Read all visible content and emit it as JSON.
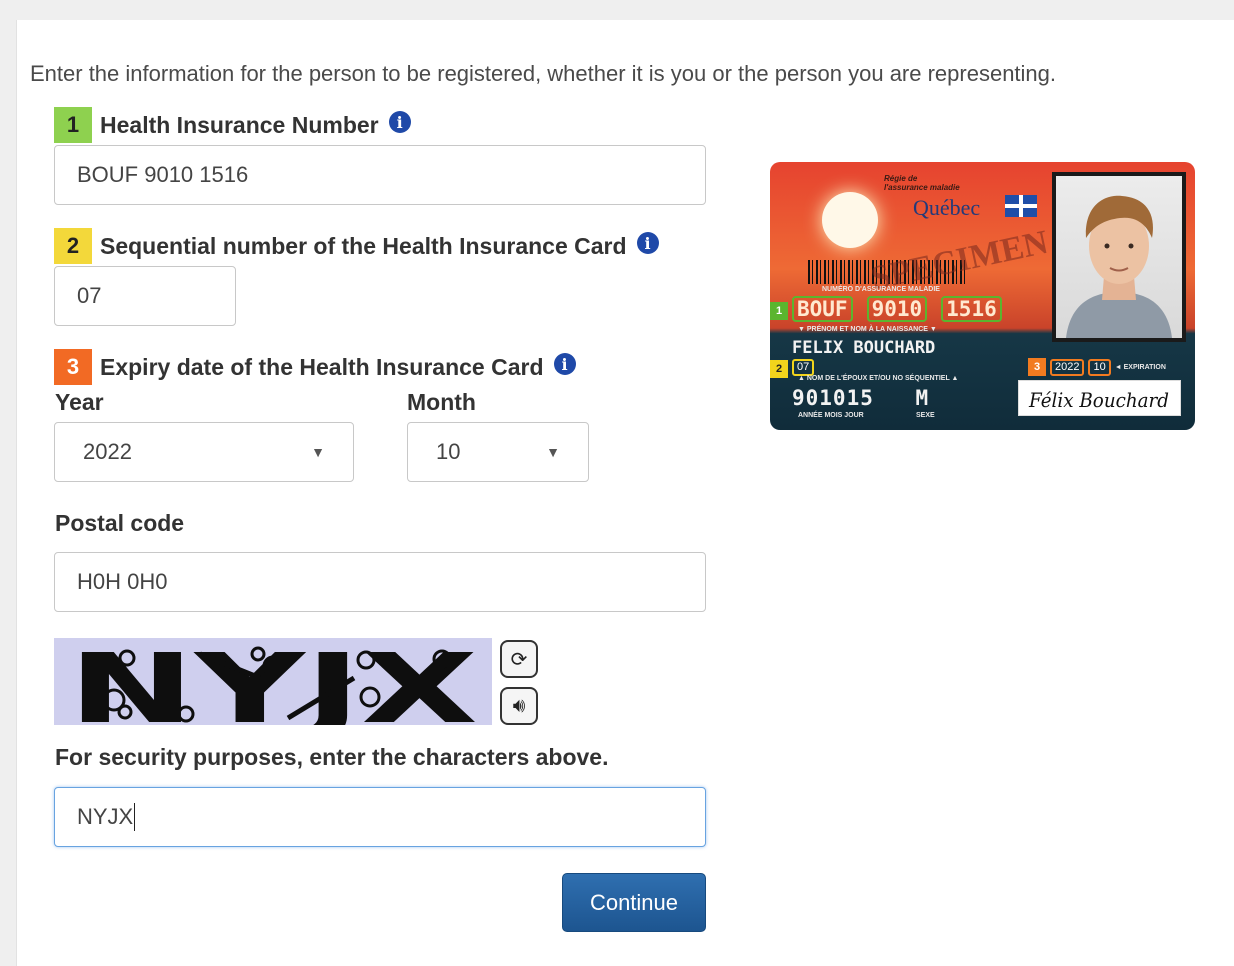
{
  "intro": "Enter the information for the person to be registered, whether it is you or the person you are representing.",
  "colors": {
    "step1": "#8ed14f",
    "step2": "#f3d83a",
    "step3": "#f26a24",
    "accent": "#1d5590"
  },
  "fields": {
    "nam": {
      "step": "1",
      "label": "Health Insurance Number",
      "value": "BOUF 9010 1516"
    },
    "seq": {
      "step": "2",
      "label": "Sequential number of the Health Insurance Card",
      "value": "07"
    },
    "expiry": {
      "step": "3",
      "label": "Expiry date of the Health Insurance Card",
      "year_label": "Year",
      "year_value": "2022",
      "month_label": "Month",
      "month_value": "10"
    },
    "postal": {
      "label": "Postal code",
      "value": "H0H 0H0"
    },
    "captcha": {
      "text": "NYJX",
      "refresh_icon": "refresh-icon",
      "audio_icon": "audio-icon"
    },
    "security": {
      "label": "For security purposes, enter the characters above.",
      "value": "NYJX"
    }
  },
  "buttons": {
    "continue": "Continue"
  },
  "card": {
    "issuer_small": "Régie de\nl'assurance maladie",
    "issuer": "Québec",
    "watermark": "SPECIMEN",
    "nam_caption": "NUMÉRO D'ASSURANCE MALADIE",
    "nam_groups": [
      "BOUF",
      "9010",
      "1516"
    ],
    "name_caption": "▼ PRÉNOM ET NOM À LA NAISSANCE ▼",
    "name": "FELIX BOUCHARD",
    "seq": "07",
    "seq_caption": "▲ NOM DE L'ÉPOUX ET/OU NO SÉQUENTIEL ▲",
    "expiry_year": "2022",
    "expiry_month": "10",
    "expiry_caption": "◄ EXPIRATION",
    "dob": "901015",
    "sex": "M",
    "dob_caption": "ANNÉE   MOIS   JOUR",
    "sex_caption": "SEXE",
    "signature": "Félix Bouchard"
  }
}
